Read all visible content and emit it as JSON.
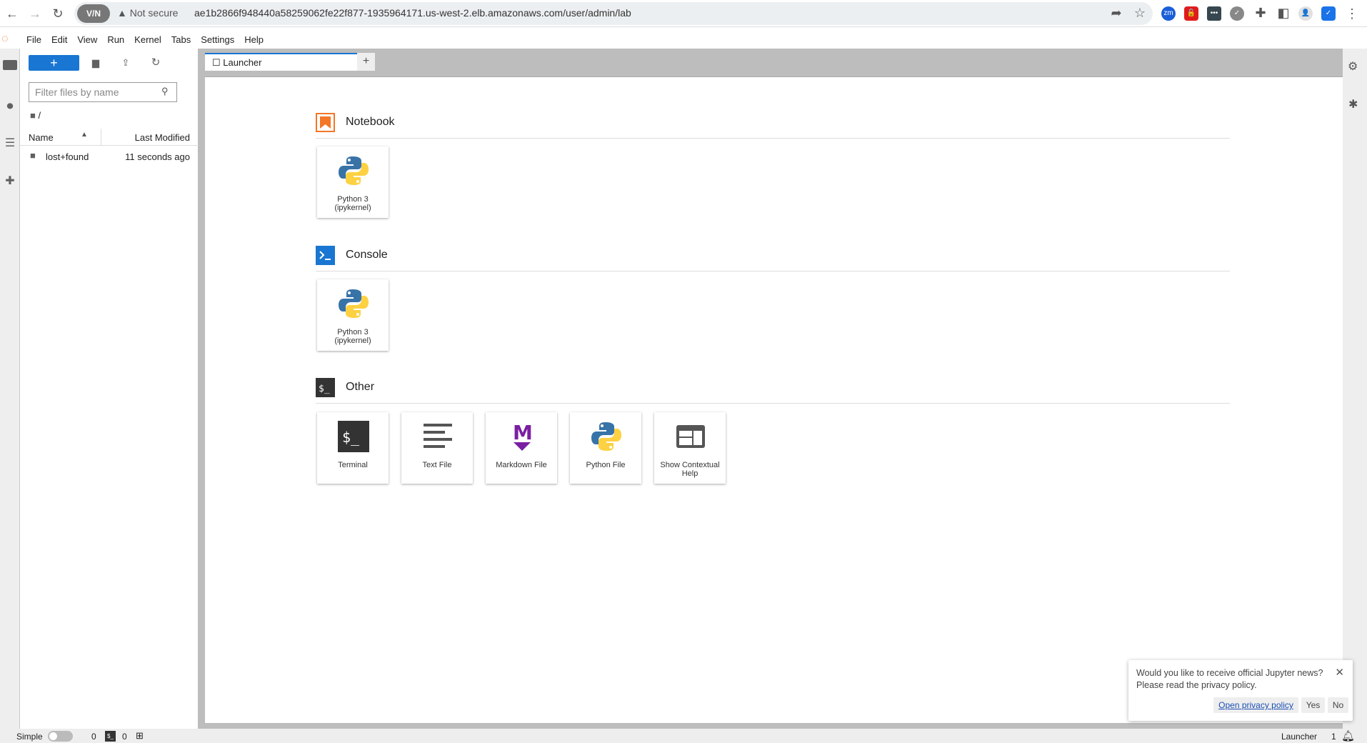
{
  "browser": {
    "vpn": "V/N",
    "security": "Not secure",
    "url": "ae1b2866f948440a58259062fe22f877-1935964171.us-west-2.elb.amazonaws.com/user/admin/lab",
    "ext_zm": "zm"
  },
  "menu": [
    "File",
    "Edit",
    "View",
    "Run",
    "Kernel",
    "Tabs",
    "Settings",
    "Help"
  ],
  "filebrowser": {
    "new_label": "+",
    "filter_placeholder": "Filter files by name",
    "path": "/",
    "col_name": "Name",
    "col_modified": "Last Modified",
    "rows": [
      {
        "name": "lost+found",
        "modified": "11 seconds ago"
      }
    ]
  },
  "tabs": [
    {
      "label": "Launcher"
    }
  ],
  "launcher": {
    "notebook": {
      "title": "Notebook",
      "cards": [
        {
          "label": "Python 3 (ipykernel)"
        }
      ]
    },
    "console": {
      "title": "Console",
      "cards": [
        {
          "label": "Python 3 (ipykernel)"
        }
      ]
    },
    "other": {
      "title": "Other",
      "cards": [
        {
          "label": "Terminal"
        },
        {
          "label": "Text File"
        },
        {
          "label": "Markdown File"
        },
        {
          "label": "Python File"
        },
        {
          "label": "Show Contextual Help"
        }
      ]
    }
  },
  "status": {
    "mode": "Simple",
    "kernels": "0",
    "terminals": "0",
    "right_label": "Launcher",
    "notif_count": "1"
  },
  "notification": {
    "line1": "Would you like to receive official Jupyter news?",
    "line2": "Please read the privacy policy.",
    "link": "Open privacy policy",
    "yes": "Yes",
    "no": "No"
  },
  "colors": {
    "accent": "#1976d2",
    "notebook": "#f37726",
    "markdown": "#7b1fa2"
  }
}
